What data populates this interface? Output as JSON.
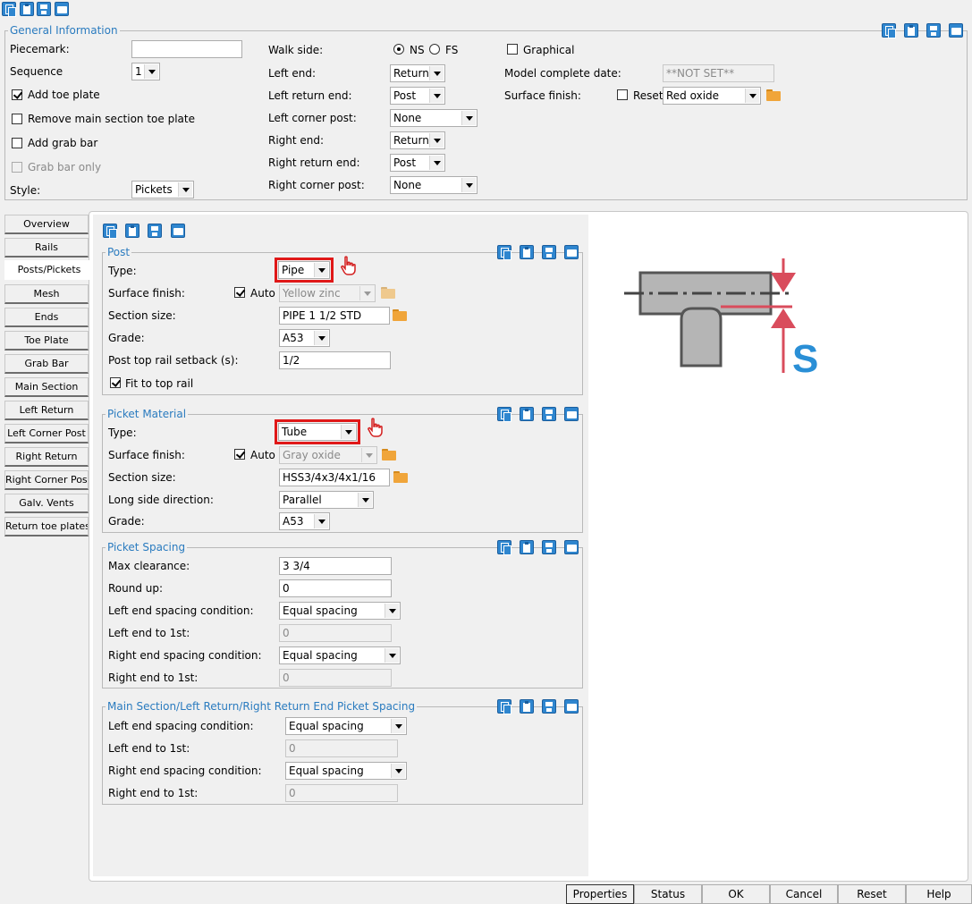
{
  "toolbar": {
    "icons": [
      "copy-icon",
      "paste-icon",
      "save-icon",
      "open-icon"
    ]
  },
  "general": {
    "title": "General Information",
    "piecemark_label": "Piecemark:",
    "piecemark_value": "",
    "sequence_label": "Sequence",
    "sequence_value": "1",
    "add_toe_plate": "Add toe plate",
    "remove_main_toe": "Remove main section toe plate",
    "add_grab_bar": "Add grab bar",
    "grab_bar_only": "Grab bar only",
    "style_label": "Style:",
    "style_value": "Pickets",
    "walk_side_label": "Walk side:",
    "walk_ns": "NS",
    "walk_fs": "FS",
    "left_end_label": "Left end:",
    "left_end_value": "Return",
    "left_return_end_label": "Left return end:",
    "left_return_end_value": "Post",
    "left_corner_post_label": "Left corner post:",
    "left_corner_post_value": "None",
    "right_end_label": "Right end:",
    "right_end_value": "Return",
    "right_return_end_label": "Right return end:",
    "right_return_end_value": "Post",
    "right_corner_post_label": "Right corner post:",
    "right_corner_post_value": "None",
    "graphical": "Graphical",
    "model_complete_label": "Model complete date:",
    "model_complete_value": "**NOT SET**",
    "surface_finish_label": "Surface finish:",
    "reset_label": "Reset",
    "surface_finish_value": "Red oxide"
  },
  "tabs": [
    "Overview",
    "Rails",
    "Posts/Pickets",
    "Mesh",
    "Ends",
    "Toe Plate",
    "Grab Bar",
    "Main Section",
    "Left Return",
    "Left Corner Post",
    "Right Return",
    "Right Corner Post",
    "Galv. Vents",
    "Return toe plates"
  ],
  "post": {
    "title": "Post",
    "type_label": "Type:",
    "type_value": "Pipe",
    "surface_finish_label": "Surface finish:",
    "auto_label": "Auto",
    "surface_finish_value": "Yellow zinc",
    "section_size_label": "Section size:",
    "section_size_value": "PIPE 1 1/2 STD",
    "grade_label": "Grade:",
    "grade_value": "A53",
    "setback_label": "Post top rail setback (s):",
    "setback_value": "1/2",
    "fit_label": "Fit to top rail"
  },
  "picket": {
    "title": "Picket Material",
    "type_label": "Type:",
    "type_value": "Tube",
    "surface_finish_label": "Surface finish:",
    "auto_label": "Auto",
    "surface_finish_value": "Gray oxide",
    "section_size_label": "Section size:",
    "section_size_value": "HSS3/4x3/4x1/16",
    "long_side_label": "Long side direction:",
    "long_side_value": "Parallel",
    "grade_label": "Grade:",
    "grade_value": "A53"
  },
  "spacing": {
    "title": "Picket Spacing",
    "max_clearance_label": "Max clearance:",
    "max_clearance_value": "3 3/4",
    "round_up_label": "Round up:",
    "round_up_value": "0",
    "left_cond_label": "Left end spacing condition:",
    "left_cond_value": "Equal spacing",
    "left_first_label": "Left end to 1st:",
    "left_first_value": "0",
    "right_cond_label": "Right end spacing condition:",
    "right_cond_value": "Equal spacing",
    "right_first_label": "Right end to 1st:",
    "right_first_value": "0"
  },
  "main_spacing": {
    "title": "Main Section/Left Return/Right Return End Picket Spacing",
    "left_cond_label": "Left end spacing condition:",
    "left_cond_value": "Equal spacing",
    "left_first_label": "Left end to 1st:",
    "left_first_value": "0",
    "right_cond_label": "Right end spacing condition:",
    "right_cond_value": "Equal spacing",
    "right_first_label": "Right end to 1st:",
    "right_first_value": "0"
  },
  "diagram": {
    "label": "S",
    "accent": "#d94c5c",
    "label_color": "#2a8fd6"
  },
  "buttons": {
    "properties": "Properties",
    "status": "Status",
    "ok": "OK",
    "cancel": "Cancel",
    "reset": "Reset",
    "help": "Help"
  }
}
